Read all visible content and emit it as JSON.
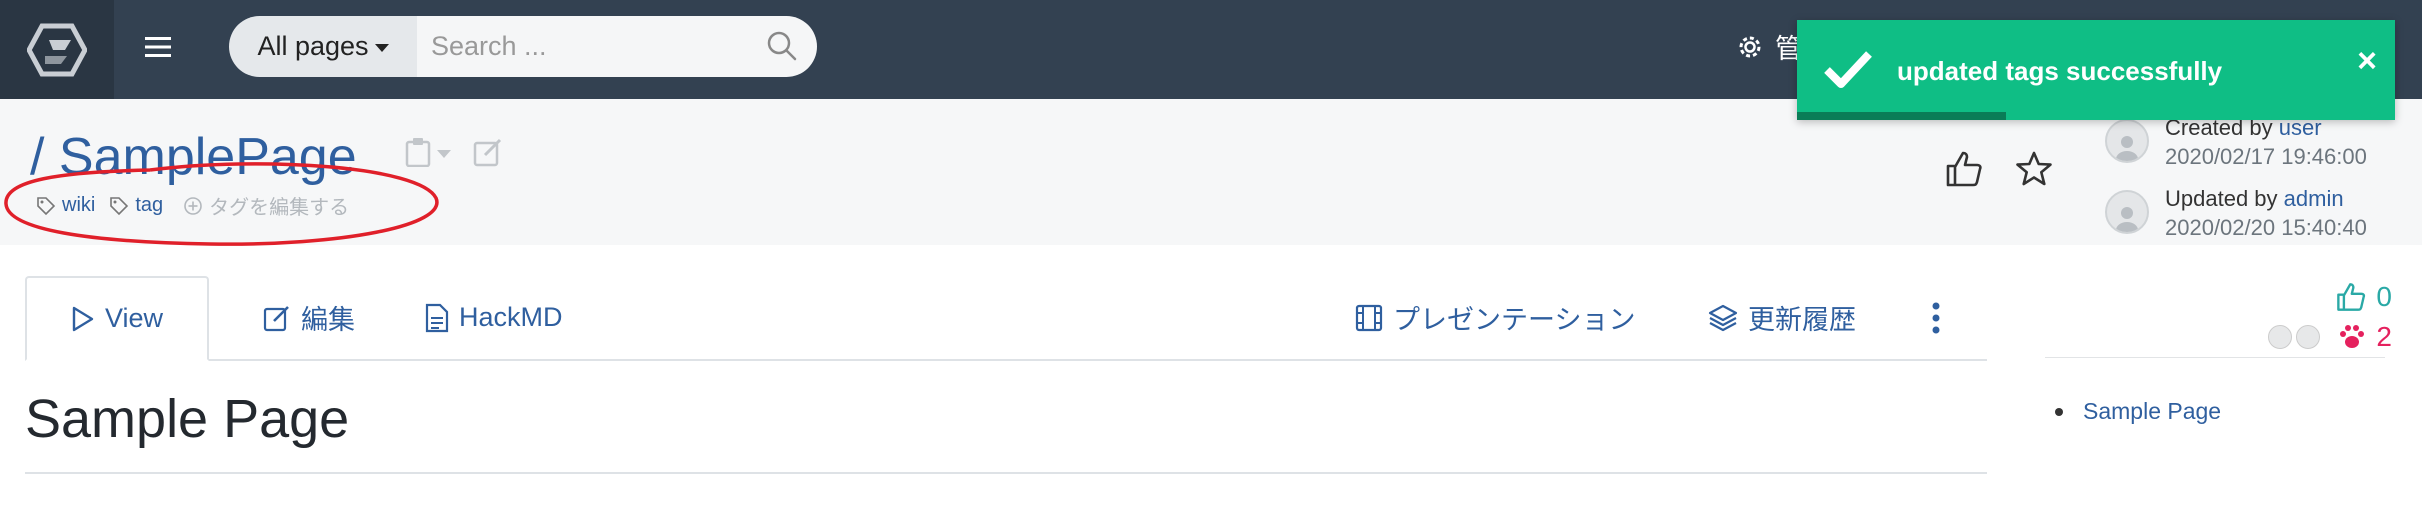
{
  "navbar": {
    "brand_icon": "growi-logo-icon",
    "menu_icon": "hamburger-icon",
    "search": {
      "scope_label": "All pages",
      "placeholder": "Search ...",
      "value": ""
    },
    "admin_label": "管"
  },
  "toast": {
    "message": "updated tags successfully",
    "close_label": "×",
    "color": "#0fbe85",
    "progress_fraction": 0.35
  },
  "page": {
    "path": "/ SamplePage",
    "tags": [
      "wiki",
      "tag"
    ],
    "edit_tags_label": "タグを編集する",
    "created": {
      "prefix": "Created by",
      "user": "user",
      "date": "2020/02/17 19:46:00"
    },
    "updated": {
      "prefix": "Updated by",
      "user": "admin",
      "date": "2020/02/20 15:40:40"
    }
  },
  "tabs": {
    "view": "View",
    "edit": "編集",
    "hackmd": "HackMD",
    "presentation": "プレゼンテーション",
    "history": "更新履歴"
  },
  "counters": {
    "likes": "0",
    "seen_by": "2"
  },
  "toc": {
    "items": [
      "Sample Page"
    ]
  },
  "content": {
    "title": "Sample Page"
  },
  "colors": {
    "navbar": "#334151",
    "link": "#2f5f9f",
    "annotation": "#e0202a",
    "likes": "#2aa9a6",
    "seen": "#e5215e"
  }
}
